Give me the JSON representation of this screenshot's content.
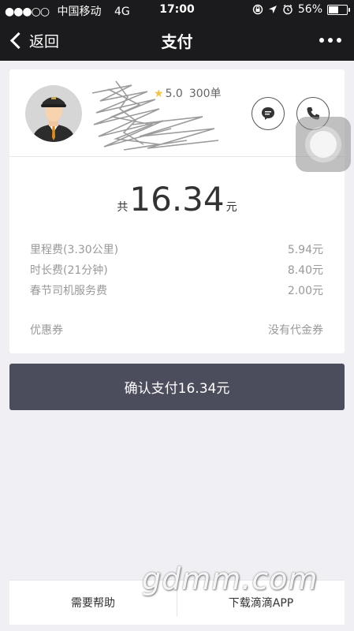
{
  "status_bar": {
    "signal": "●●●○○",
    "carrier": "中国移动",
    "network": "4G",
    "time": "17:00",
    "battery_percent": "56%",
    "battery_level": 0.56
  },
  "nav": {
    "back_label": "返回",
    "title": "支付"
  },
  "driver": {
    "rating": "5.0",
    "orders": "300单"
  },
  "fare": {
    "prefix": "共",
    "amount": "16.34",
    "unit": "元",
    "items": [
      {
        "label": "里程费(3.30公里)",
        "value": "5.94元"
      },
      {
        "label": "时长费(21分钟)",
        "value": "8.40元"
      },
      {
        "label": "春节司机服务费",
        "value": "2.00元"
      }
    ],
    "coupon_label": "优惠券",
    "coupon_value": "没有代金券"
  },
  "confirm_label": "确认支付16.34元",
  "bottom": {
    "help_label": "需要帮助",
    "download_label": "下载滴滴APP"
  },
  "watermark": "gdmm.com",
  "colors": {
    "topbar": "#1b1b1d",
    "confirm_button": "#4b4c5c",
    "background": "#efeff4"
  }
}
